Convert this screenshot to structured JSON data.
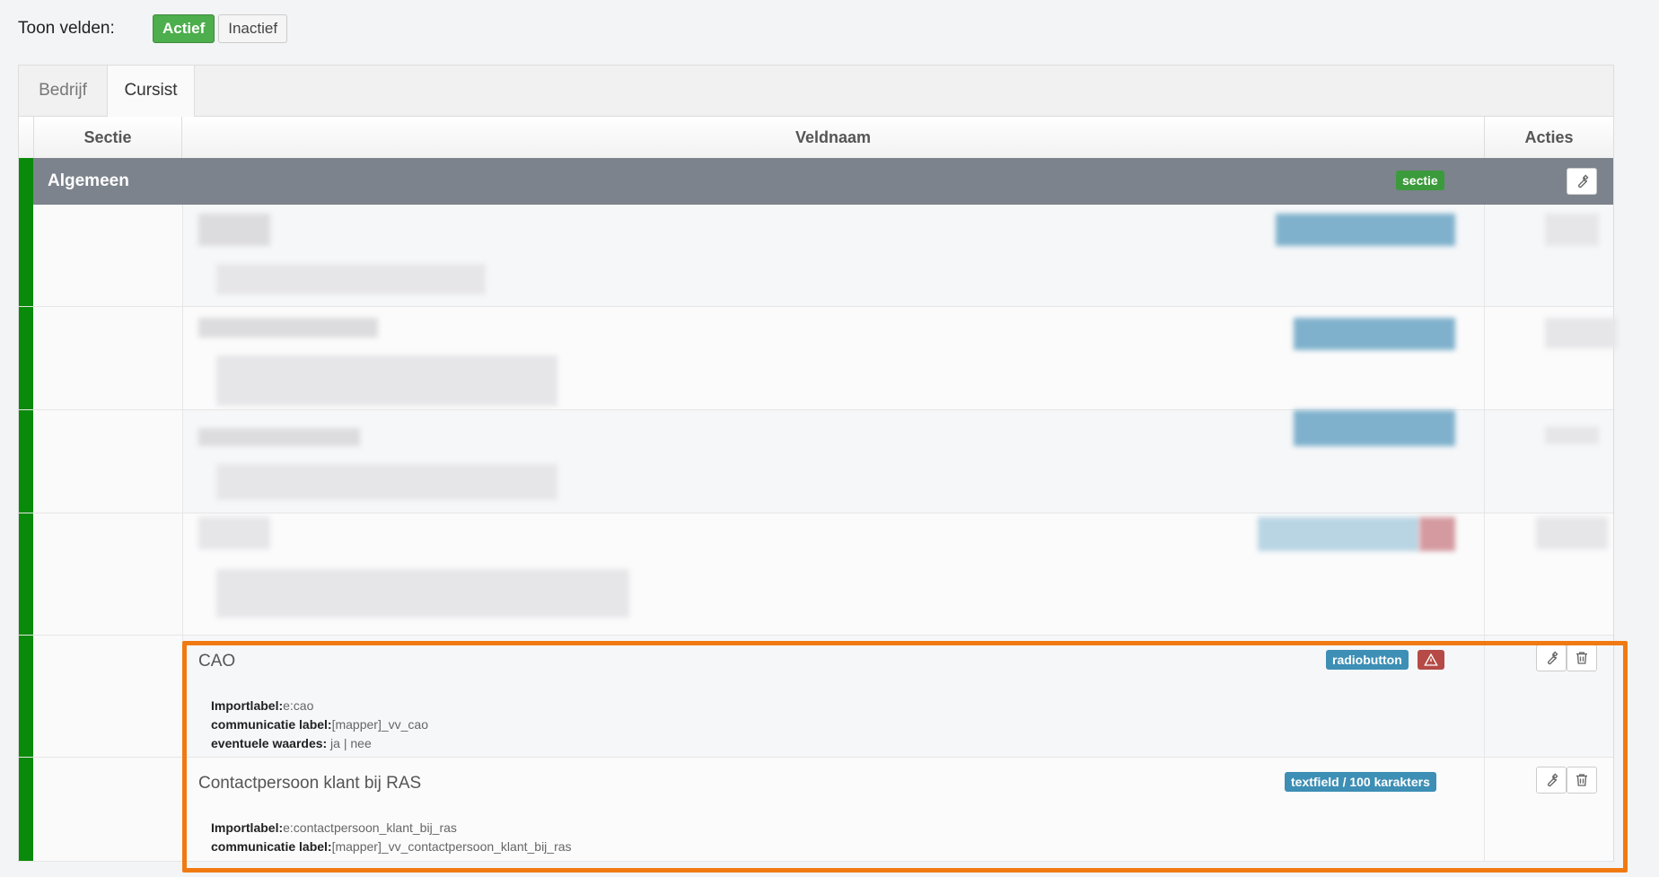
{
  "toolbar": {
    "label": "Toon velden:",
    "active_button": "Actief",
    "inactive_button": "Inactief"
  },
  "tabs": [
    {
      "label": "Bedrijf"
    },
    {
      "label": "Cursist"
    }
  ],
  "table": {
    "headers": {
      "sectie": "Sectie",
      "veldnaam": "Veldnaam",
      "acties": "Acties"
    },
    "section": {
      "title": "Algemeen",
      "badge": "sectie"
    },
    "fields": [
      {
        "name": "CAO",
        "type_badge": "radiobutton",
        "warning_icon": "warning-icon",
        "importlabel_key": "Importlabel:",
        "importlabel_value": "e:cao",
        "comm_key": "communicatie label:",
        "comm_value": "[mapper]_vv_cao",
        "values_key": "eventuele waardes:",
        "values_value": " ja | nee"
      },
      {
        "name": "Contactpersoon klant bij RAS",
        "type_badge": "textfield / 100 karakters",
        "importlabel_key": "Importlabel:",
        "importlabel_value": "e:contactpersoon_klant_bij_ras",
        "comm_key": "communicatie label:",
        "comm_value": "[mapper]_vv_contactpersoon_klant_bij_ras"
      }
    ]
  },
  "icons": {
    "edit": "wrench-icon",
    "delete": "trash-icon"
  },
  "colors": {
    "green": "#4cae4c",
    "section_bg": "#7c838c",
    "badge_blue": "#3d8fb5",
    "highlight": "#f07a12"
  }
}
